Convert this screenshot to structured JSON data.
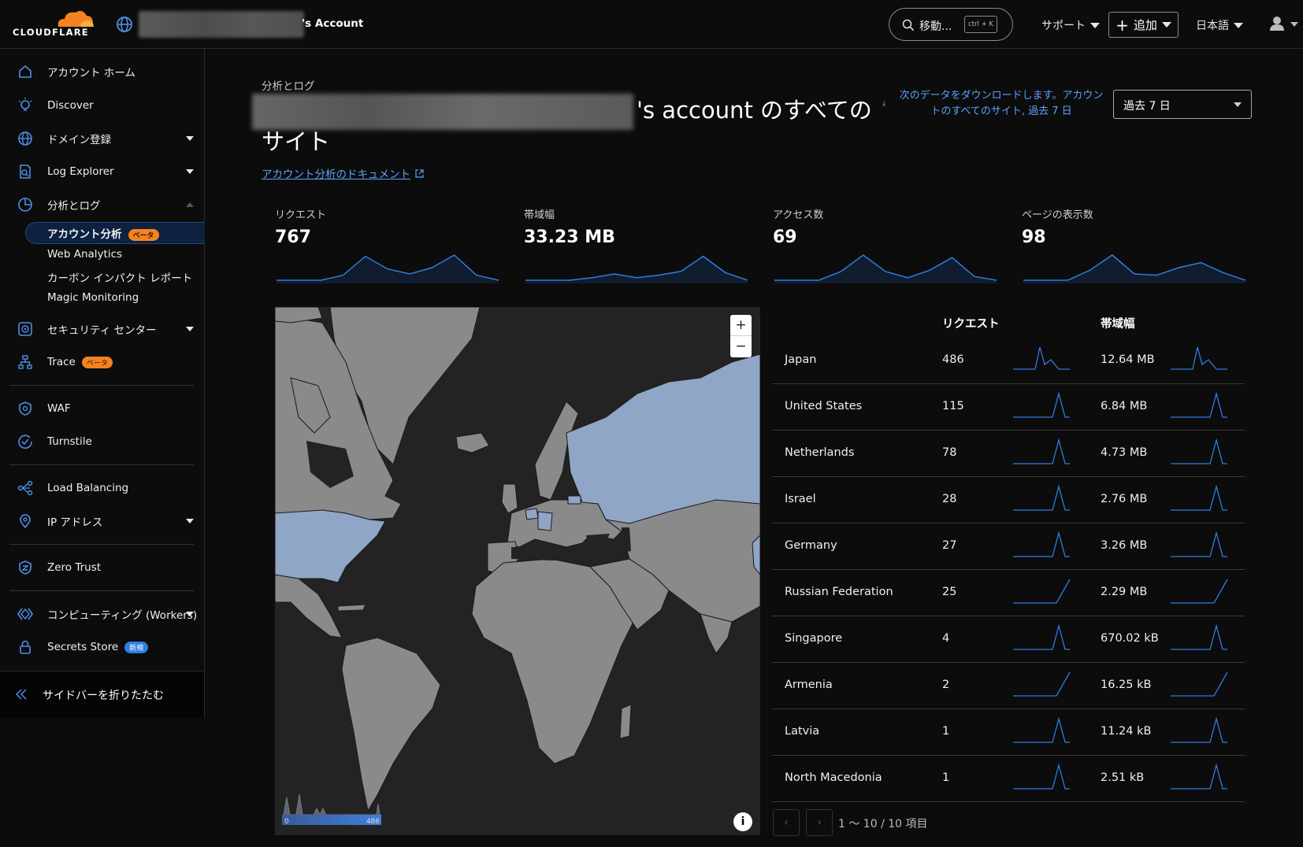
{
  "topbar": {
    "logo_text": "CLOUDFLARE",
    "account_name": "'s Account",
    "search_text": "移動...",
    "search_shortcut": "ctrl + K",
    "support_label": "サポート",
    "add_label": "追加",
    "language_label": "日本語"
  },
  "sidebar": {
    "items": [
      {
        "label": "アカウント ホーム",
        "icon": "home-icon"
      },
      {
        "label": "Discover",
        "icon": "lightbulb-icon"
      },
      {
        "label": "ドメイン登録",
        "icon": "globe-icon"
      },
      {
        "label": "Log Explorer",
        "icon": "document-icon"
      },
      {
        "label": "分析とログ",
        "icon": "pie-chart-icon"
      },
      {
        "label": "セキュリティ センター",
        "icon": "radar-icon"
      },
      {
        "label": "Trace",
        "icon": "tree-icon"
      },
      {
        "label": "WAF",
        "icon": "shield-icon"
      },
      {
        "label": "Turnstile",
        "icon": "turnstile-icon"
      },
      {
        "label": "Load Balancing",
        "icon": "share-icon"
      },
      {
        "label": "IP アドレス",
        "icon": "pin-icon"
      },
      {
        "label": "Zero Trust",
        "icon": "zero-trust-icon"
      },
      {
        "label": "コンピューティング (Workers)",
        "icon": "workers-icon"
      },
      {
        "label": "Secrets Store",
        "icon": "lock-icon"
      }
    ],
    "subitems": [
      {
        "label": "アカウント分析"
      },
      {
        "label": "Web Analytics"
      },
      {
        "label": "カーボン インパクト レポート"
      },
      {
        "label": "Magic Monitoring"
      }
    ],
    "badge_beta": "ベータ",
    "badge_new": "新規",
    "collapse_label": "サイドバーを折りたたむ"
  },
  "main": {
    "breadcrumb": "分析とログ",
    "title": "'s account のすべてのサイト",
    "doc_link": "アカウント分析のドキュメント",
    "download_text": "次のデータをダウンロードします。アカウントのすべてのサイト, 過去 7 日",
    "range_label": "過去 7 日"
  },
  "stats": [
    {
      "label": "リクエスト",
      "value": "767",
      "trend": [
        0,
        0,
        0,
        0.2,
        0.95,
        0.45,
        0.25,
        0.5,
        1,
        0.2,
        0
      ]
    },
    {
      "label": "帯域幅",
      "value": "33.23 MB",
      "trend": [
        0,
        0,
        0,
        0.1,
        0.25,
        0.1,
        0.2,
        0.35,
        0.95,
        0.3,
        0
      ]
    },
    {
      "label": "アクセス数",
      "value": "69",
      "trend": [
        0,
        0,
        0,
        0.35,
        1,
        0.35,
        0.1,
        0.4,
        0.9,
        0.15,
        0
      ]
    },
    {
      "label": "ページの表示数",
      "value": "98",
      "trend": [
        0,
        0,
        0,
        0.4,
        1,
        0.25,
        0.2,
        0.5,
        0.7,
        0.3,
        0
      ]
    }
  ],
  "table": {
    "col_requests": "リクエスト",
    "col_bandwidth": "帯域幅",
    "rows": [
      {
        "country": "Japan",
        "requests": "486",
        "bandwidth": "12.64 MB"
      },
      {
        "country": "United States",
        "requests": "115",
        "bandwidth": "6.84 MB"
      },
      {
        "country": "Netherlands",
        "requests": "78",
        "bandwidth": "4.73 MB"
      },
      {
        "country": "Israel",
        "requests": "28",
        "bandwidth": "2.76 MB"
      },
      {
        "country": "Germany",
        "requests": "27",
        "bandwidth": "3.26 MB"
      },
      {
        "country": "Russian Federation",
        "requests": "25",
        "bandwidth": "2.29 MB"
      },
      {
        "country": "Singapore",
        "requests": "4",
        "bandwidth": "670.02 kB"
      },
      {
        "country": "Armenia",
        "requests": "2",
        "bandwidth": "16.25 kB"
      },
      {
        "country": "Latvia",
        "requests": "1",
        "bandwidth": "11.24 kB"
      },
      {
        "country": "North Macedonia",
        "requests": "1",
        "bandwidth": "2.51 kB"
      }
    ],
    "pagination": "1 〜 10 / 10 項目"
  },
  "map": {
    "legend_min": "0",
    "legend_max": "486",
    "highlight_color": "#8fa6c6",
    "land_color": "#8a8a8a",
    "ocean_color": "#232323"
  },
  "colors": {
    "accent": "#2e7de0",
    "brand_orange": "#f6821f",
    "link": "#5aa2ff"
  }
}
